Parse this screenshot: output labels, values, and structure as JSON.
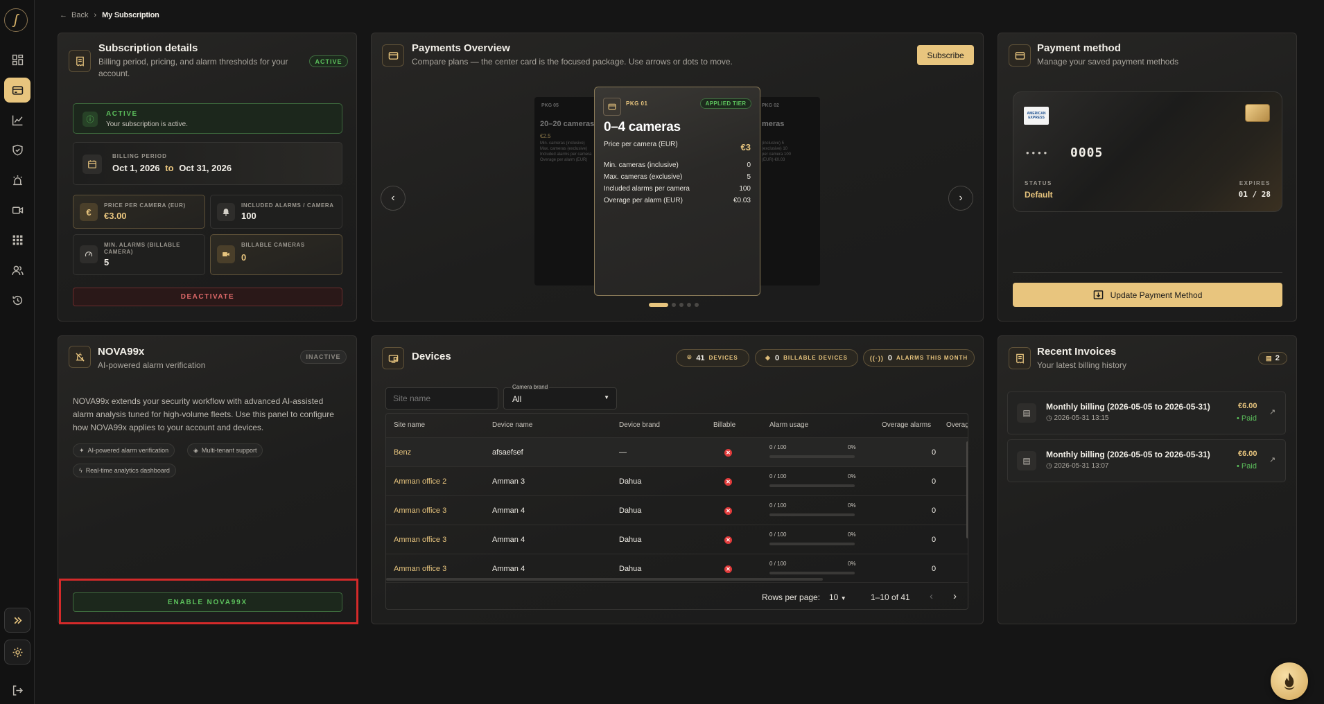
{
  "breadcrumb": {
    "back": "Back",
    "current": "My Subscription"
  },
  "colors": {
    "accent": "#e8c57e",
    "success": "#4caf50",
    "danger": "#e23b3b",
    "background": "#151515"
  },
  "subscription": {
    "title": "Subscription details",
    "subtitle": "Billing period, pricing, and alarm thresholds for your account.",
    "status_pill": "ACTIVE",
    "alert_title": "ACTIVE",
    "alert_text": "Your subscription is active.",
    "billing_label": "BILLING PERIOD",
    "billing_start": "Oct 1, 2026",
    "billing_to": "to",
    "billing_end": "Oct 31, 2026",
    "tiles": [
      {
        "label": "PRICE PER CAMERA (EUR)",
        "value": "€3.00"
      },
      {
        "label": "INCLUDED ALARMS / CAMERA",
        "value": "100"
      },
      {
        "label": "MIN. ALARMS (BILLABLE CAMERA)",
        "value": "5"
      },
      {
        "label": "BILLABLE CAMERAS",
        "value": "0"
      }
    ],
    "deactivate": "DEACTIVATE"
  },
  "payments": {
    "title": "Payments Overview",
    "subtitle": "Compare plans — the center card is the focused package. Use arrows or dots to move.",
    "subscribe": "Subscribe",
    "left_pkg": {
      "tag": "PKG 05",
      "title": "20–20 cameras",
      "price": "€2.5",
      "rows": [
        "Min. cameras (inclusive)",
        "Max. cameras (exclusive)",
        "Included alarms per camera",
        "Overage per alarm (EUR)"
      ]
    },
    "right_pkg": {
      "tag": "PKG 02",
      "title": "meras",
      "rows": [
        "(inclusive) 5",
        "(exclusive) 10",
        "per camera 100",
        "(EUR) €0.03"
      ]
    },
    "main_pkg": {
      "tag": "PKG 01",
      "badge": "APPLIED TIER",
      "title": "0–4 cameras",
      "price_label": "Price per camera (EUR)",
      "price": "€3",
      "rows": [
        {
          "label": "Min. cameras (inclusive)",
          "value": "0"
        },
        {
          "label": "Max. cameras (exclusive)",
          "value": "5"
        },
        {
          "label": "Included alarms per camera",
          "value": "100"
        },
        {
          "label": "Overage per alarm (EUR)",
          "value": "€0.03"
        }
      ]
    },
    "active_dot": 0,
    "dot_count": 5
  },
  "payment_method": {
    "title": "Payment method",
    "subtitle": "Manage your saved payment methods",
    "card_brand": "AMERICAN EXPRESS",
    "masked": "••••",
    "last4": "0005",
    "status_label": "STATUS",
    "status_value": "Default",
    "expires_label": "EXPIRES",
    "expires_value": "01 / 28",
    "update_btn": "Update Payment Method"
  },
  "nova": {
    "title": "NOVA99x",
    "subtitle": "AI-powered alarm verification",
    "status_pill": "INACTIVE",
    "description": "NOVA99x extends your security workflow with advanced AI-assisted alarm analysis tuned for high-volume fleets. Use this panel to configure how NOVA99x applies to your account and devices.",
    "chips": [
      "AI-powered alarm verification",
      "Multi-tenant support",
      "Real-time analytics dashboard"
    ],
    "enable_btn": "ENABLE NOVA99X"
  },
  "devices": {
    "title": "Devices",
    "stats": [
      {
        "value": "41",
        "label": "DEVICES"
      },
      {
        "value": "0",
        "label": "BILLABLE DEVICES"
      },
      {
        "value": "0",
        "label": "ALARMS THIS MONTH"
      }
    ],
    "site_placeholder": "Site name",
    "brand_label": "Camera brand",
    "brand_value": "All",
    "columns": [
      "Site name",
      "Device name",
      "Device brand",
      "Billable",
      "Alarm usage",
      "Overage alarms",
      "Overag"
    ],
    "rows": [
      {
        "site": "Benz",
        "device": "afsaefsef",
        "brand": "—",
        "usage": "0 / 100",
        "pct": "0%",
        "overage": "0"
      },
      {
        "site": "Amman office 2",
        "device": "Amman 3",
        "brand": "Dahua",
        "usage": "0 / 100",
        "pct": "0%",
        "overage": "0"
      },
      {
        "site": "Amman office 3",
        "device": "Amman 4",
        "brand": "Dahua",
        "usage": "0 / 100",
        "pct": "0%",
        "overage": "0"
      },
      {
        "site": "Amman office 3",
        "device": "Amman 4",
        "brand": "Dahua",
        "usage": "0 / 100",
        "pct": "0%",
        "overage": "0"
      },
      {
        "site": "Amman office 3",
        "device": "Amman 4",
        "brand": "Dahua",
        "usage": "0 / 100",
        "pct": "0%",
        "overage": "0"
      }
    ],
    "rows_per_page_label": "Rows per page:",
    "rows_per_page": "10",
    "range": "1–10 of 41"
  },
  "invoices": {
    "title": "Recent Invoices",
    "subtitle": "Your latest billing history",
    "count": "2",
    "items": [
      {
        "title": "Monthly billing (2026-05-05 to 2026-05-31)",
        "date": "2026-05-31 13:15",
        "amount": "€6.00",
        "status": "Paid"
      },
      {
        "title": "Monthly billing (2026-05-05 to 2026-05-31)",
        "date": "2026-05-31 13:07",
        "amount": "€6.00",
        "status": "Paid"
      }
    ]
  }
}
